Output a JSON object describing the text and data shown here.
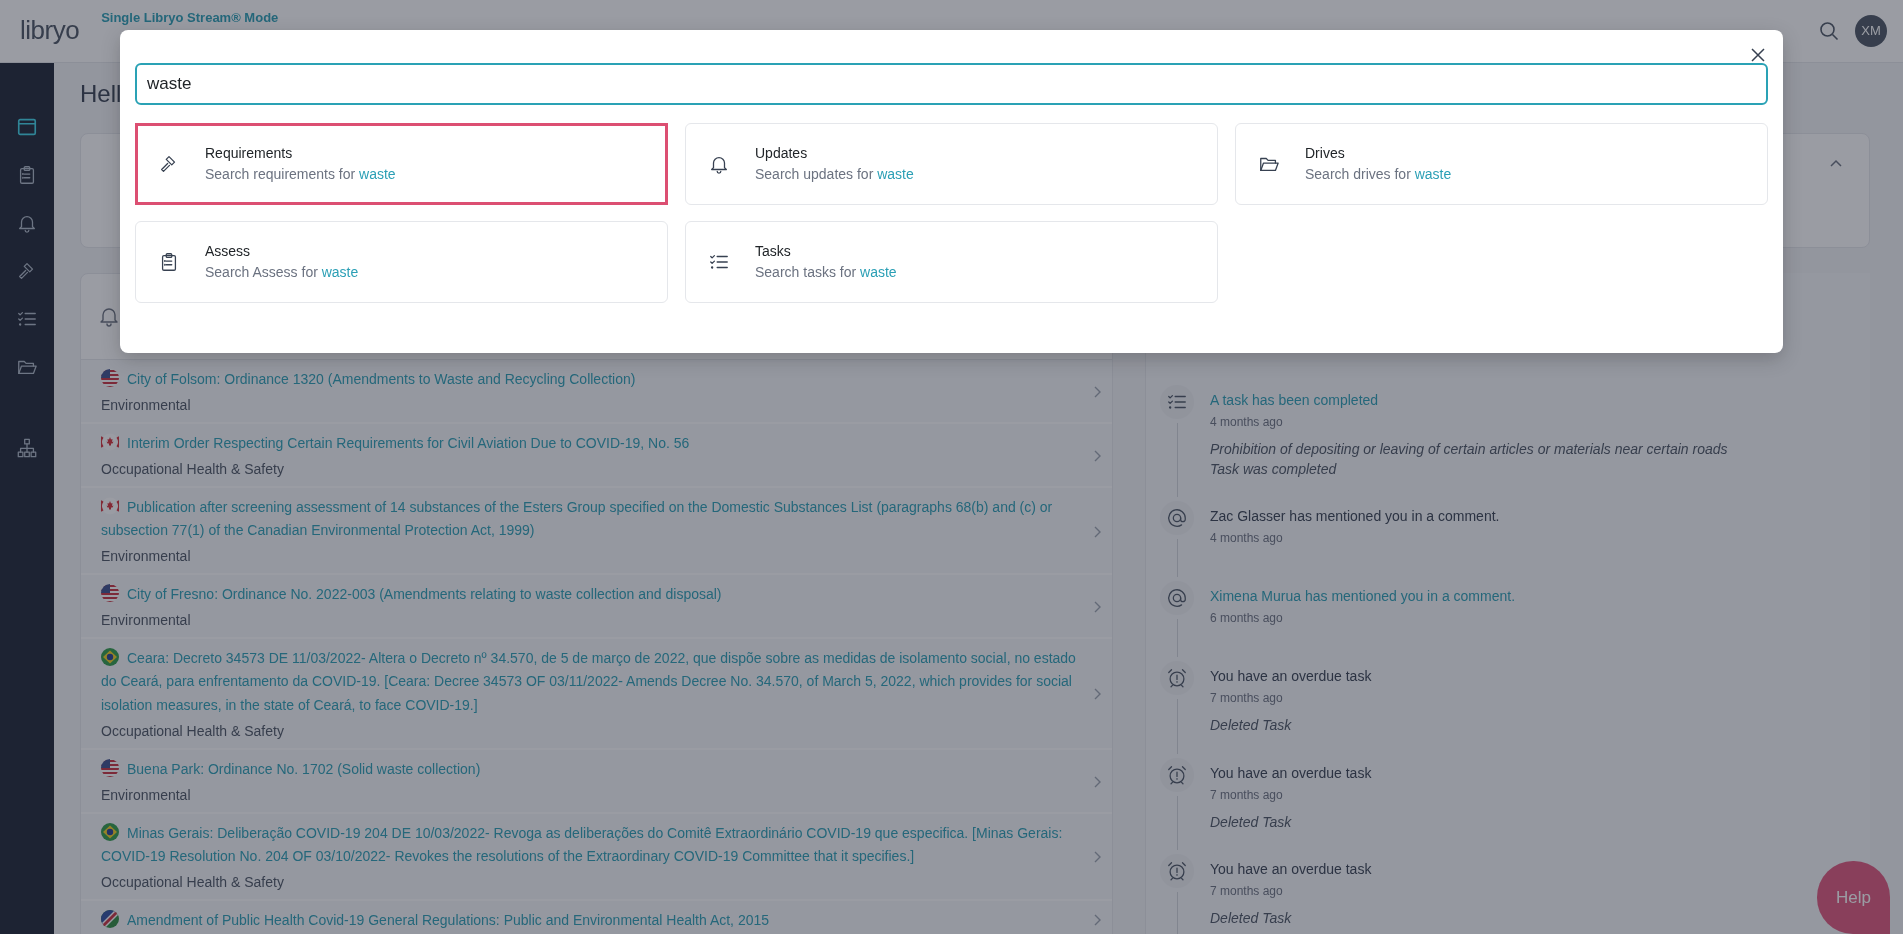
{
  "topbar": {
    "logo": "libryo",
    "mode": "Single Libryo Stream® Mode",
    "avatar": "XM"
  },
  "sidebar": {
    "items": [
      {
        "kind": "window",
        "selected": true
      },
      {
        "kind": "clipboard",
        "selected": false
      },
      {
        "kind": "bell",
        "selected": false
      },
      {
        "kind": "gavel",
        "selected": false
      },
      {
        "kind": "checklist",
        "selected": false
      },
      {
        "kind": "folder",
        "selected": false
      }
    ],
    "extra_items": [
      {
        "kind": "sitemap",
        "selected": false
      }
    ]
  },
  "greeting": "Hell",
  "feed": {
    "items": [
      {
        "kind": "us",
        "title": "City of Folsom: Ordinance 1320 (Amendments to Waste and Recycling Collection)",
        "category": "Environmental"
      },
      {
        "kind": "ca",
        "title": "Interim Order Respecting Certain Requirements for Civil Aviation Due to COVID-19, No. 56",
        "category": "Occupational Health & Safety"
      },
      {
        "kind": "ca",
        "title": "Publication after screening assessment of 14 substances of the Esters Group specified on the Domestic Substances List (paragraphs 68(b) and (c) or subsection 77(1) of the Canadian Environmental Protection Act, 1999)",
        "category": "Environmental"
      },
      {
        "kind": "us",
        "title": "City of Fresno: Ordinance No. 2022-003 (Amendments relating to waste collection and disposal)",
        "category": "Environmental"
      },
      {
        "kind": "br",
        "title": "Ceara: Decreto 34573 DE 11/03/2022- Altera o Decreto nº 34.570, de 5 de março de 2022, que dispõe sobre as medidas de isolamento social, no estado do Ceará, para enfrentamento da COVID-19. [Ceara: Decree 34573 OF 03/11/2022- Amends Decree No. 34.570, of March 5, 2022, which provides for social isolation measures, in the state of Ceará, to face COVID-19.]",
        "category": "Occupational Health & Safety"
      },
      {
        "kind": "us",
        "title": "Buena Park: Ordinance No. 1702 (Solid waste collection)",
        "category": "Environmental"
      },
      {
        "kind": "br",
        "title": "Minas Gerais: Deliberação COVID-19 204 DE 10/03/2022- Revoga as deliberações do Comitê Extraordinário COVID-19 que especifica. [Minas Gerais: COVID-19 Resolution No. 204 OF 03/10/2022- Revokes the resolutions of the Extraordinary COVID-19 Committee that it specifies.]",
        "category": "Occupational Health & Safety"
      },
      {
        "kind": "na",
        "title": "Amendment of Public Health Covid-19 General Regulations: Public and Environmental Health Act, 2015"
      }
    ]
  },
  "activity": {
    "items": [
      {
        "kind": "task",
        "title": "A task has been completed",
        "link": true,
        "time": "4 months ago",
        "details": [
          "Prohibition of depositing or leaving of certain articles or materials near certain roads",
          "Task was completed"
        ]
      },
      {
        "kind": "mention",
        "title": "Zac Glasser has mentioned you in a comment.",
        "link": false,
        "time": "4 months ago"
      },
      {
        "kind": "mention",
        "title": "Ximena Murua has mentioned you in a comment.",
        "link": true,
        "time": "6 months ago"
      },
      {
        "kind": "overdue",
        "title": "You have an overdue task",
        "link": false,
        "time": "7 months ago",
        "details": [
          "Deleted Task"
        ]
      },
      {
        "kind": "overdue",
        "title": "You have an overdue task",
        "link": false,
        "time": "7 months ago",
        "details": [
          "Deleted Task"
        ]
      },
      {
        "kind": "overdue",
        "title": "You have an overdue task",
        "link": false,
        "time": "7 months ago",
        "details": [
          "Deleted Task"
        ]
      }
    ]
  },
  "help": "Help",
  "search_modal": {
    "query": "waste",
    "options": [
      {
        "kind": "gavel",
        "title": "Requirements",
        "description": "Search requirements for",
        "term": "waste",
        "selected": true
      },
      {
        "kind": "bell",
        "title": "Updates",
        "description": "Search updates for",
        "term": "waste",
        "selected": false
      },
      {
        "kind": "folder",
        "title": "Drives",
        "description": "Search drives for",
        "term": "waste",
        "selected": false
      },
      {
        "kind": "clipboard",
        "title": "Assess",
        "description": "Search Assess for",
        "term": "waste",
        "selected": false
      },
      {
        "kind": "checklist",
        "title": "Tasks",
        "description": "Search tasks for",
        "term": "waste",
        "selected": false
      }
    ]
  }
}
